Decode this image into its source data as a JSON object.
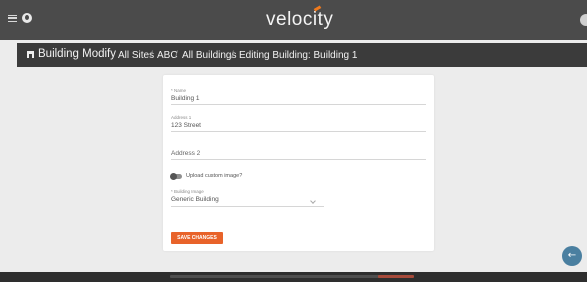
{
  "app": {
    "logo_text": "velocity"
  },
  "header": {
    "page_title": "Building Modify",
    "breadcrumbs": [
      "All Sites",
      "ABC",
      "All Buildings",
      "Editing Building: Building 1"
    ]
  },
  "form": {
    "name": {
      "label": "* Name",
      "value": "Building 1"
    },
    "address1": {
      "label": "Address 1",
      "value": "123 Street"
    },
    "address2": {
      "placeholder": "Address 2"
    },
    "custom_image": {
      "label": "Upload custom image?",
      "checked": false
    },
    "building_image": {
      "label": "* Building Image",
      "value": "Generic Building"
    },
    "save_label": "SAVE CHANGES"
  },
  "fab": {
    "icon": "arrow-left-icon",
    "glyph": "←"
  },
  "colors": {
    "topbar": "#4b4b4b",
    "navbar": "#3b3b3b",
    "accent": "#e8632a",
    "fab": "#4a7fa0"
  }
}
